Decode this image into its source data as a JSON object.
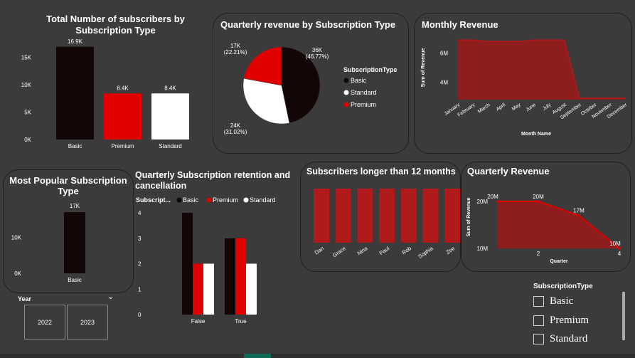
{
  "colors": {
    "basic": "#130606",
    "premium": "#e00000",
    "standard": "#ffffff",
    "area": "#8e1d1d",
    "area_line": "#b01a1a",
    "bar_red": "#b01a1a"
  },
  "charts": {
    "total": {
      "title": "Total Number of subscribers by Subscription Type"
    },
    "pie": {
      "title": "Quarterly revenue by Subscription Type",
      "legend_title": "SubscriptionType"
    },
    "monthly": {
      "title": "Monthly Revenue"
    },
    "popular": {
      "title": "Most Popular Subscription Type"
    },
    "retention": {
      "title": "Quarterly Subscription retention and cancellation",
      "legend_title": "Subscript..."
    },
    "longer": {
      "title": "Subscribers longer than 12 months"
    },
    "quarterly": {
      "title": "Quarterly Revenue"
    }
  },
  "chart_data": [
    {
      "type": "bar",
      "title": "Total Number of subscribers by Subscription Type",
      "categories": [
        "Basic",
        "Premium",
        "Standard"
      ],
      "values": [
        16900,
        8400,
        8400
      ],
      "data_labels": [
        "16.9K",
        "8.4K",
        "8.4K"
      ],
      "yticks": [
        "0K",
        "5K",
        "10K",
        "15K"
      ],
      "ylim": [
        0,
        17000
      ],
      "grid": false
    },
    {
      "type": "pie",
      "title": "Quarterly revenue by Subscription Type",
      "legend_title": "SubscriptionType",
      "legend_position": "right",
      "slices": [
        {
          "name": "Basic",
          "value": 36000,
          "label": "36K",
          "pct": "(46.77%)"
        },
        {
          "name": "Standard",
          "value": 24000,
          "label": "24K",
          "pct": "(31.02%)"
        },
        {
          "name": "Premium",
          "value": 17000,
          "label": "17K",
          "pct": "(22.21%)"
        }
      ]
    },
    {
      "type": "area",
      "title": "Monthly Revenue",
      "xlabel": "Month Name",
      "ylabel": "Sum of Revenue",
      "categories": [
        "January",
        "February",
        "March",
        "April",
        "May",
        "June",
        "July",
        "August",
        "September",
        "October",
        "November",
        "December"
      ],
      "values": [
        6.9,
        6.9,
        6.8,
        6.8,
        6.8,
        6.9,
        6.9,
        6.9,
        2.9,
        2.9,
        2.9,
        2.9
      ],
      "yticks": [
        "4M",
        "6M"
      ],
      "ylim": [
        2.8,
        7.2
      ]
    },
    {
      "type": "bar",
      "title": "Most Popular Subscription Type",
      "categories": [
        "Basic"
      ],
      "values": [
        17000
      ],
      "data_labels": [
        "17K"
      ],
      "yticks": [
        "0K",
        "10K"
      ],
      "ylim": [
        0,
        19000
      ]
    },
    {
      "type": "bar",
      "title": "Quarterly Subscription retention and cancellation",
      "legend_title": "Subscript...",
      "legend_position": "top",
      "categories": [
        "False",
        "True"
      ],
      "series": [
        {
          "name": "Basic",
          "values": [
            4,
            3
          ]
        },
        {
          "name": "Premium",
          "values": [
            2,
            3
          ]
        },
        {
          "name": "Standard",
          "values": [
            2,
            2
          ]
        }
      ],
      "yticks": [
        "0",
        "1",
        "2",
        "3",
        "4"
      ],
      "ylim": [
        0,
        4
      ]
    },
    {
      "type": "bar",
      "title": "Subscribers longer than 12 months",
      "categories": [
        "Dan",
        "Grace",
        "Nina",
        "Paul",
        "Rob",
        "Sophia",
        "Zoe"
      ],
      "values": [
        1,
        1,
        1,
        1,
        1,
        1,
        1
      ]
    },
    {
      "type": "area",
      "title": "Quarterly Revenue",
      "xlabel": "Quarter",
      "ylabel": "Sum of Revenue",
      "x": [
        1,
        2,
        3,
        4
      ],
      "values": [
        20,
        20,
        17,
        10
      ],
      "data_labels": [
        "20M",
        "20M",
        "17M",
        "10M"
      ],
      "xticks": [
        "2",
        "4"
      ],
      "yticks": [
        "10M",
        "20M"
      ],
      "ylim": [
        10,
        21.5
      ]
    }
  ],
  "slicer": {
    "title": "Year",
    "chevron": "⌄",
    "options": [
      "2022",
      "2023"
    ]
  },
  "type_filter": {
    "title": "SubscriptionType",
    "options": [
      "Basic",
      "Premium",
      "Standard"
    ]
  }
}
